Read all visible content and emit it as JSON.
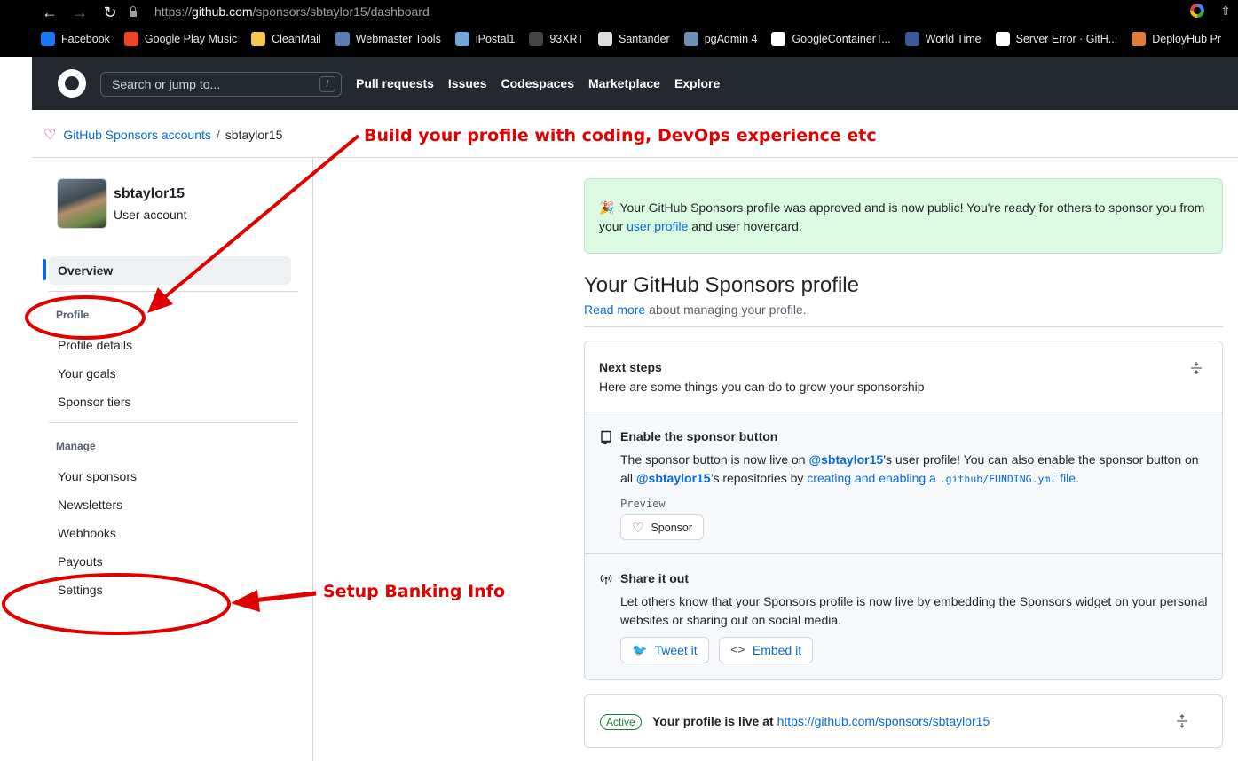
{
  "browser": {
    "url_prefix": "https://",
    "url_host": "github.com",
    "url_path": "/sponsors/sbtaylor15/dashboard",
    "bookmarks": [
      {
        "label": "Facebook",
        "color": "#1877f2"
      },
      {
        "label": "Google Play Music",
        "color": "#ef4423"
      },
      {
        "label": "CleanMail",
        "color": "#f2c94c"
      },
      {
        "label": "Webmaster Tools",
        "color": "#5b7db1"
      },
      {
        "label": "iPostal1",
        "color": "#6fa8dc"
      },
      {
        "label": "93XRT",
        "color": "#444444"
      },
      {
        "label": "Santander",
        "color": "#dddddd"
      },
      {
        "label": "pgAdmin 4",
        "color": "#6e8fb8"
      },
      {
        "label": "GoogleContainerT...",
        "color": "#ffffff"
      },
      {
        "label": "World Time",
        "color": "#3b5998"
      },
      {
        "label": "Server Error · GitH...",
        "color": "#ffffff"
      },
      {
        "label": "DeployHub Pr",
        "color": "#e07b39"
      }
    ]
  },
  "header": {
    "search_placeholder": "Search or jump to...",
    "search_shortcut": "/",
    "nav": [
      "Pull requests",
      "Issues",
      "Codespaces",
      "Marketplace",
      "Explore"
    ]
  },
  "breadcrumb": {
    "root": "GitHub Sponsors accounts",
    "separator": "/",
    "current": "sbtaylor15"
  },
  "sidebar": {
    "username": "sbtaylor15",
    "account_type": "User account",
    "overview": "Overview",
    "profile_heading": "Profile",
    "profile_items": [
      "Profile details",
      "Your goals",
      "Sponsor tiers"
    ],
    "manage_heading": "Manage",
    "manage_items": [
      "Your sponsors",
      "Newsletters",
      "Webhooks",
      "Payouts",
      "Settings"
    ]
  },
  "annotations": {
    "profile_note": "Build your profile with coding, DevOps experience etc",
    "settings_note": "Setup Banking Info",
    "color": "#e00000"
  },
  "flash": {
    "emoji": "🎉",
    "text_before": "Your GitHub Sponsors profile was approved and is now public! You're ready for others to sponsor you from your ",
    "link": "user profile",
    "text_after": " and user hovercard."
  },
  "main": {
    "title": "Your GitHub Sponsors profile",
    "read_more": "Read more",
    "subtitle_rest": " about managing your profile.",
    "next_steps_title": "Next steps",
    "next_steps_desc": "Here are some things you can do to grow your sponsorship",
    "enable": {
      "title": "Enable the sponsor button",
      "t1": "The sponsor button is now live on ",
      "user1": "@sbtaylor15",
      "t2": "’s user profile! You can also enable the sponsor button on all ",
      "user2": "@sbtaylor15",
      "t3": "’s repositories by ",
      "link_a": "creating and enabling a ",
      "link_code": ".github/FUNDING.yml",
      "link_b": " file",
      "t4": ".",
      "preview_label": "Preview",
      "sponsor_btn": "Sponsor"
    },
    "share": {
      "title": "Share it out",
      "desc": "Let others know that your Sponsors profile is now live by embedding the Sponsors widget on your personal websites or sharing out on social media.",
      "tweet_btn": "Tweet it",
      "embed_btn": "Embed it"
    },
    "active": {
      "badge": "Active",
      "text": "Your profile is live at ",
      "link": "https://github.com/sponsors/sbtaylor15"
    }
  }
}
